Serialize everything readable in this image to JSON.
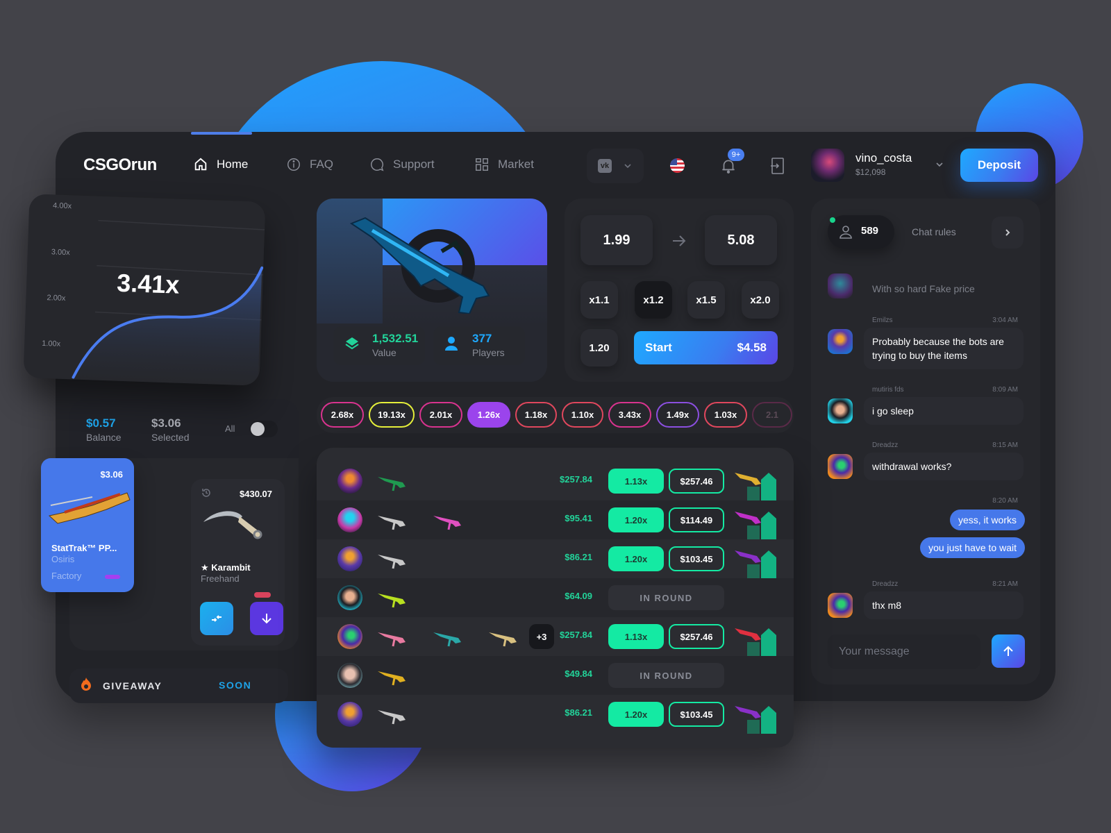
{
  "header": {
    "logo": "CSGOrun",
    "nav": [
      {
        "label": "Home",
        "icon": "home-icon",
        "active": true
      },
      {
        "label": "FAQ",
        "icon": "info-icon",
        "active": false
      },
      {
        "label": "Support",
        "icon": "chat-bubble-icon",
        "active": false
      },
      {
        "label": "Market",
        "icon": "grid-icon",
        "active": false
      }
    ],
    "social_select": "VK",
    "language_flag": "US",
    "notification_badge": "9+",
    "user": {
      "name": "vino_costa",
      "balance": "$12,098"
    },
    "deposit_label": "Deposit"
  },
  "graph": {
    "current_multiplier": "3.41x",
    "y_labels": [
      "4.00x",
      "3.00x",
      "2.00x",
      "1.00x"
    ]
  },
  "wallet": {
    "balance_value": "$0.57",
    "balance_label": "Balance",
    "selected_value": "$3.06",
    "selected_label": "Selected",
    "all_label": "All",
    "all_toggle_on": false,
    "items": [
      {
        "price": "$3.06",
        "name": "StatTrak™ PP...",
        "skin": "Osiris",
        "condition": "Factory",
        "rarity_color": "#a53ff0",
        "selected": true
      },
      {
        "price": "$430.07",
        "name": "★ Karambit",
        "skin": "Freehand",
        "rarity_color": "#d9435c",
        "selected": false
      }
    ]
  },
  "giveaway": {
    "label": "GIVEAWAY",
    "status": "SOON"
  },
  "jackpot": {
    "value": "1,532.51",
    "value_label": "Value",
    "players": "377",
    "players_label": "Players"
  },
  "bet_panel": {
    "from": "1.99",
    "to": "5.08",
    "quick_multipliers": [
      "x1.1",
      "x1.2",
      "x1.5",
      "x2.0"
    ],
    "active_multiplier": "x1.2",
    "auto_cashout": "1.20",
    "start_label": "Start",
    "start_amount": "$4.58"
  },
  "history": [
    {
      "value": "2.68x",
      "color": "#d9338f"
    },
    {
      "value": "19.13x",
      "color": "#e5ef3a"
    },
    {
      "value": "2.01x",
      "color": "#d9338f"
    },
    {
      "value": "1.26x",
      "color": "#9b44ec",
      "filled": true
    },
    {
      "value": "1.18x",
      "color": "#e0475d"
    },
    {
      "value": "1.10x",
      "color": "#e0475d"
    },
    {
      "value": "3.43x",
      "color": "#d9338f"
    },
    {
      "value": "1.49x",
      "color": "#8b4fe0"
    },
    {
      "value": "1.03x",
      "color": "#e0475d"
    },
    {
      "value": "2.1",
      "color": "#5a2a48"
    }
  ],
  "bets": [
    {
      "amount": "$257.84",
      "multiplier": "1.13x",
      "win": "$257.46",
      "status": "won",
      "extra": ""
    },
    {
      "amount": "$95.41",
      "multiplier": "1.20x",
      "win": "$114.49",
      "status": "won",
      "extra": ""
    },
    {
      "amount": "$86.21",
      "multiplier": "1.20x",
      "win": "$103.45",
      "status": "won",
      "extra": ""
    },
    {
      "amount": "$64.09",
      "status": "in_round",
      "status_label": "IN ROUND",
      "extra": ""
    },
    {
      "amount": "$257.84",
      "multiplier": "1.13x",
      "win": "$257.46",
      "status": "won",
      "extra": "+3"
    },
    {
      "amount": "$49.84",
      "status": "in_round",
      "status_label": "IN ROUND",
      "extra": ""
    },
    {
      "amount": "$86.21",
      "multiplier": "1.20x",
      "win": "$103.45",
      "status": "won",
      "extra": ""
    }
  ],
  "chat": {
    "online_count": "589",
    "rules_label": "Chat rules",
    "messages": [
      {
        "author": "",
        "time": "",
        "text": "With so hard Fake price",
        "faded": true
      },
      {
        "author": "Emilzs",
        "time": "3:04 AM",
        "text": "Probably because the bots are trying to buy the items"
      },
      {
        "author": "mutiris fds",
        "time": "8:09 AM",
        "text": "i go sleep"
      },
      {
        "author": "Dreadzz",
        "time": "8:15 AM",
        "text": "withdrawal works?"
      }
    ],
    "own_time": "8:20 AM",
    "own_messages": [
      "yess, it works",
      "you just have to wait"
    ],
    "last_message": {
      "author": "Dreadzz",
      "time": "8:21 AM",
      "text": "thx m8"
    },
    "input_placeholder": "Your message"
  },
  "colors": {
    "accent_blue": "#4678ea",
    "accent_green": "#14eaa3",
    "accent_cyan": "#1ea3e8",
    "deposit_gradient_start": "#1ea9ff",
    "deposit_gradient_end": "#5a46e6"
  }
}
